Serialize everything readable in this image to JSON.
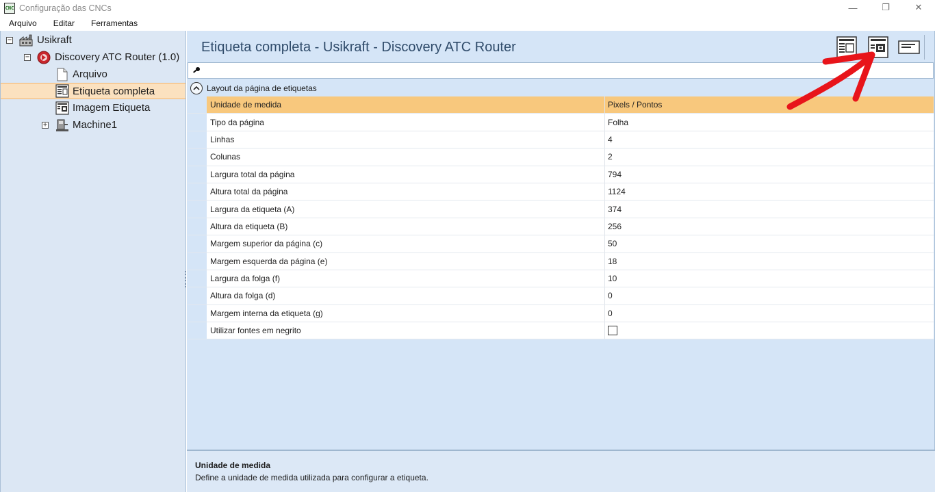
{
  "window": {
    "app_icon_text": "CNC",
    "title": "Configuração das CNCs",
    "minimize_glyph": "—",
    "maximize_glyph": "❐",
    "close_glyph": "✕"
  },
  "menu": {
    "items": [
      "Arquivo",
      "Editar",
      "Ferramentas"
    ]
  },
  "tree": {
    "root": {
      "label": "Usikraft",
      "expander": "−",
      "icon": "factory-icon"
    },
    "machine": {
      "label": "Discovery ATC Router (1.0)",
      "expander": "−",
      "icon": "router-logo-icon"
    },
    "children": [
      {
        "label": "Arquivo",
        "icon": "file-icon"
      },
      {
        "label": "Etiqueta completa",
        "icon": "label-layout-icon",
        "selected": true
      },
      {
        "label": "Imagem Etiqueta",
        "icon": "label-image-icon"
      }
    ],
    "machine1": {
      "label": "Machine1",
      "expander": "+",
      "icon": "machine-icon"
    }
  },
  "main": {
    "title": "Etiqueta completa - Usikraft - Discovery ATC Router",
    "search": {
      "value": "",
      "placeholder": ""
    },
    "group_label": "Layout da página de etiquetas",
    "properties": [
      {
        "name": "Unidade de medida",
        "value": "Pixels / Pontos",
        "selected": true
      },
      {
        "name": "Tipo da página",
        "value": "Folha"
      },
      {
        "name": "Linhas",
        "value": "4"
      },
      {
        "name": "Colunas",
        "value": "2"
      },
      {
        "name": "Largura total da página",
        "value": "794"
      },
      {
        "name": "Altura total da página",
        "value": "1124"
      },
      {
        "name": "Largura da etiqueta (A)",
        "value": "374"
      },
      {
        "name": "Altura da etiqueta (B)",
        "value": "256"
      },
      {
        "name": "Margem superior da página (c)",
        "value": "50"
      },
      {
        "name": "Margem esquerda da página (e)",
        "value": "18"
      },
      {
        "name": "Largura da folga (f)",
        "value": "10"
      },
      {
        "name": "Altura da folga (d)",
        "value": "0"
      },
      {
        "name": "Margem interna da etiqueta (g)",
        "value": "0"
      },
      {
        "name": "Utilizar fontes em negrito",
        "value": "",
        "checkbox": true,
        "checked": false
      }
    ],
    "description": {
      "title": "Unidade de medida",
      "text": "Define a unidade de medida utilizada para configurar a etiqueta."
    }
  },
  "colors": {
    "selected_tree": "#fbe1bf",
    "selected_row": "#f8c87d",
    "panel_bg": "#d5e5f7",
    "annotation_arrow": "#e8141a"
  }
}
